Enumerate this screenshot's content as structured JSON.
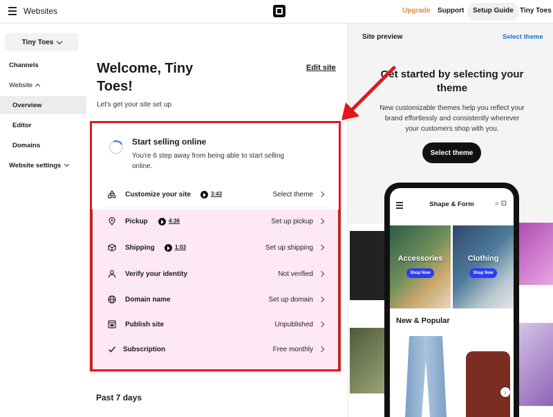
{
  "topbar": {
    "app_title": "Websites",
    "upgrade": "Upgrade",
    "support": "Support",
    "setup_guide": "Setup Guide",
    "account": "Tiny Toes",
    "upgrade_color": "#e8883a"
  },
  "sidebar": {
    "business": "Tiny Toes",
    "items": [
      {
        "label": "Channels"
      },
      {
        "label": "Website"
      },
      {
        "label": "Overview"
      },
      {
        "label": "Editor"
      },
      {
        "label": "Domains"
      },
      {
        "label": "Website settings"
      }
    ]
  },
  "main": {
    "welcome": "Welcome, Tiny Toes!",
    "edit_site": "Edit site",
    "subtitle": "Let's get your site set up",
    "start_title": "Start selling online",
    "start_desc": "You're 6 step away from being able to start selling online.",
    "tasks": [
      {
        "label": "Customize your site",
        "video": "3:43",
        "status": "Select theme",
        "icon": "theme-icon"
      },
      {
        "label": "Pickup",
        "video": "4:36",
        "status": "Set up pickup",
        "icon": "location-pin-icon"
      },
      {
        "label": "Shipping",
        "video": "1:03",
        "status": "Set up shipping",
        "icon": "box-icon"
      },
      {
        "label": "Verify your identity",
        "status": "Not verified",
        "icon": "person-icon"
      },
      {
        "label": "Domain name",
        "status": "Set up domain",
        "icon": "globe-icon"
      },
      {
        "label": "Publish site",
        "status": "Unpublished",
        "icon": "publish-icon"
      },
      {
        "label": "Subscription",
        "status": "Free monthly",
        "icon": "check-icon"
      }
    ],
    "past7": "Past 7 days"
  },
  "preview": {
    "label": "Site preview",
    "select_theme_link": "Select theme",
    "title": "Get started by selecting your theme",
    "desc": "New customizable themes help you reflect your brand effortlessly and consistently wherever your customers shop with you.",
    "select_theme_button": "Select theme",
    "phone": {
      "brand": "Shape & Form",
      "tile_a": "Accessories",
      "tile_b": "Clothing",
      "shop_now": "Shop Now",
      "section": "New & Popular"
    },
    "accent_link_color": "#1a6fd1"
  }
}
